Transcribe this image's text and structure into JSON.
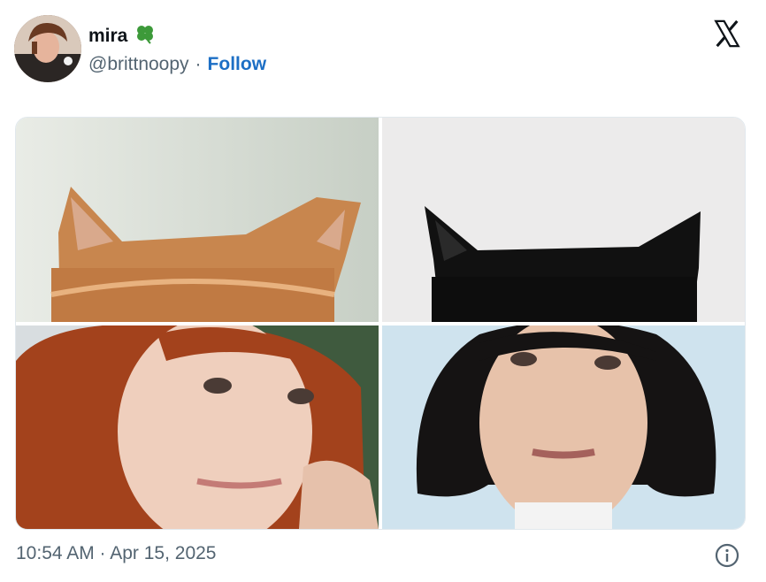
{
  "tweet": {
    "display_name": "mira",
    "name_emoji": "four-leaf-clover",
    "handle": "@brittnoopy",
    "separator": "·",
    "follow_label": "Follow",
    "timestamp": "10:54 AM · Apr 15, 2025"
  },
  "media": {
    "images": [
      {
        "subject": "orange-cat-ears"
      },
      {
        "subject": "black-cat-ears"
      },
      {
        "subject": "red-haired-woman"
      },
      {
        "subject": "black-bob-woman"
      }
    ]
  },
  "icons": {
    "brand": "x-logo-icon",
    "info": "info-icon",
    "clover": "clover-icon"
  },
  "colors": {
    "follow": "#1d6fc5",
    "secondary_text": "#536471",
    "primary_text": "#0f1419",
    "clover": "#3d9a3a"
  }
}
